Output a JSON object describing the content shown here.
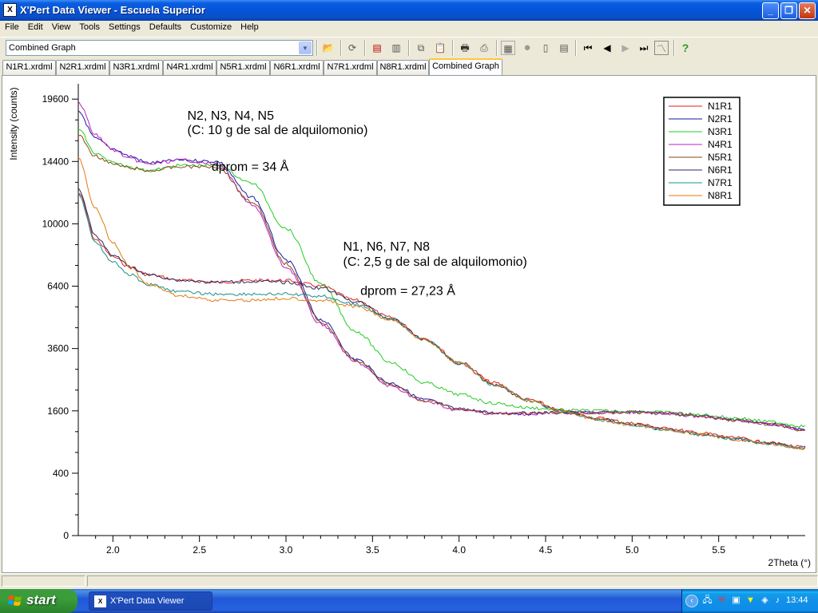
{
  "window": {
    "title": "X'Pert Data Viewer - Escuela Superior",
    "icon": "xpert-app-icon"
  },
  "menu": [
    "File",
    "Edit",
    "View",
    "Tools",
    "Settings",
    "Defaults",
    "Customize",
    "Help"
  ],
  "toolbar": {
    "graph_select_value": "Combined Graph",
    "icons": [
      "open-folder-icon",
      "refresh-icon",
      "export-icon",
      "copy-icon",
      "paste-icon",
      "print-icon",
      "print-preview-icon",
      "graph-icon",
      "stop-icon",
      "document-icon",
      "first-icon",
      "prev-icon",
      "next-icon",
      "last-icon",
      "plot-icon",
      "help-icon"
    ]
  },
  "tabs": [
    {
      "label": "N1R1.xrdml"
    },
    {
      "label": "N2R1.xrdml"
    },
    {
      "label": "N3R1.xrdml"
    },
    {
      "label": "N4R1.xrdml"
    },
    {
      "label": "N5R1.xrdml"
    },
    {
      "label": "N6R1.xrdml"
    },
    {
      "label": "N7R1.xrdml"
    },
    {
      "label": "N8R1.xrdml"
    },
    {
      "label": "Combined Graph",
      "active": true
    }
  ],
  "chart_data": {
    "type": "line",
    "xlabel": "2Theta (°)",
    "ylabel": "Intensity (counts)",
    "xlim": [
      1.8,
      6.0
    ],
    "y_ticks": [
      0,
      400,
      1600,
      3600,
      6400,
      10000,
      14400,
      19600
    ],
    "x_ticks": [
      "2.0",
      "2.5",
      "3.0",
      "3.5",
      "4.0",
      "4.5",
      "5.0",
      "5.5"
    ],
    "y_scale": "sqrt",
    "legend_position": "top-right",
    "series": [
      {
        "name": "N1R1",
        "color": "#e02020",
        "group": "low",
        "x": [
          1.8,
          1.9,
          2.0,
          2.1,
          2.2,
          2.4,
          2.6,
          2.8,
          3.0,
          3.2,
          3.4,
          3.6,
          3.8,
          4.0,
          4.2,
          4.4,
          4.6,
          4.8,
          5.0,
          5.2,
          5.4,
          5.6,
          5.8,
          6.0
        ],
        "y": [
          12100,
          9000,
          8000,
          7400,
          7000,
          6700,
          6600,
          6700,
          6700,
          6400,
          5700,
          4900,
          4000,
          3100,
          2400,
          1900,
          1600,
          1420,
          1300,
          1180,
          1080,
          980,
          880,
          800
        ]
      },
      {
        "name": "N2R1",
        "color": "#1a1aa0",
        "group": "high",
        "x": [
          1.8,
          1.9,
          2.0,
          2.1,
          2.2,
          2.4,
          2.6,
          2.8,
          3.0,
          3.2,
          3.4,
          3.6,
          3.8,
          4.0,
          4.2,
          4.4,
          4.6,
          4.8,
          5.0,
          5.2,
          5.4,
          5.6,
          5.8,
          6.0
        ],
        "y": [
          18500,
          16200,
          15400,
          14800,
          14300,
          14500,
          14400,
          11800,
          7800,
          4800,
          3200,
          2400,
          1900,
          1650,
          1550,
          1540,
          1560,
          1560,
          1570,
          1540,
          1470,
          1380,
          1280,
          1150
        ]
      },
      {
        "name": "N3R1",
        "color": "#22cc22",
        "group": "high",
        "x": [
          1.8,
          1.9,
          2.0,
          2.1,
          2.2,
          2.4,
          2.6,
          2.8,
          3.0,
          3.2,
          3.4,
          3.6,
          3.8,
          4.0,
          4.2,
          4.4,
          4.6,
          4.8,
          5.0,
          5.2,
          5.4,
          5.6,
          5.8,
          6.0
        ],
        "y": [
          17000,
          15000,
          14300,
          14000,
          13700,
          14100,
          14100,
          12800,
          9700,
          6500,
          4300,
          3100,
          2400,
          2050,
          1800,
          1680,
          1620,
          1600,
          1590,
          1560,
          1500,
          1420,
          1330,
          1230
        ]
      },
      {
        "name": "N4R1",
        "color": "#c020c0",
        "group": "high",
        "x": [
          1.8,
          1.9,
          2.0,
          2.1,
          2.2,
          2.4,
          2.6,
          2.8,
          3.0,
          3.2,
          3.4,
          3.6,
          3.8,
          4.0,
          4.2,
          4.4,
          4.6,
          4.8,
          5.0,
          5.2,
          5.4,
          5.6,
          5.8,
          6.0
        ],
        "y": [
          19300,
          16500,
          15300,
          14600,
          14200,
          14500,
          14200,
          11300,
          7400,
          4600,
          3100,
          2300,
          1850,
          1620,
          1530,
          1520,
          1550,
          1550,
          1560,
          1530,
          1460,
          1370,
          1270,
          1140
        ]
      },
      {
        "name": "N5R1",
        "color": "#8b4a1a",
        "group": "high",
        "x": [
          1.8,
          1.9,
          2.0,
          2.1,
          2.2,
          2.4,
          2.6,
          2.8,
          3.0,
          3.2,
          3.4,
          3.6,
          3.8,
          4.0,
          4.2,
          4.4,
          4.6,
          4.8,
          5.0,
          5.2,
          5.4,
          5.6,
          5.8,
          6.0
        ],
        "y": [
          16500,
          14800,
          14200,
          13900,
          13700,
          14000,
          14000,
          11500,
          7600,
          4700,
          3150,
          2350,
          1880,
          1640,
          1540,
          1530,
          1550,
          1550,
          1560,
          1530,
          1460,
          1370,
          1270,
          1140
        ]
      },
      {
        "name": "N6R1",
        "color": "#2a2a60",
        "group": "low",
        "x": [
          1.8,
          1.9,
          2.0,
          2.1,
          2.2,
          2.4,
          2.6,
          2.8,
          3.0,
          3.2,
          3.4,
          3.6,
          3.8,
          4.0,
          4.2,
          4.4,
          4.6,
          4.8,
          5.0,
          5.2,
          5.4,
          5.6,
          5.8,
          6.0
        ],
        "y": [
          12400,
          9200,
          8100,
          7450,
          7000,
          6700,
          6600,
          6650,
          6600,
          6300,
          5650,
          4850,
          3950,
          3050,
          2350,
          1880,
          1580,
          1400,
          1280,
          1160,
          1060,
          960,
          870,
          790
        ]
      },
      {
        "name": "N7R1",
        "color": "#1a8f8f",
        "group": "low",
        "x": [
          1.8,
          1.9,
          2.0,
          2.1,
          2.2,
          2.4,
          2.6,
          2.8,
          3.0,
          3.2,
          3.4,
          3.6,
          3.8,
          4.0,
          4.2,
          4.4,
          4.6,
          4.8,
          5.0,
          5.2,
          5.4,
          5.6,
          5.8,
          6.0
        ],
        "y": [
          12000,
          8800,
          7700,
          7000,
          6500,
          6100,
          6000,
          6000,
          6000,
          5900,
          5500,
          4850,
          3950,
          3050,
          2350,
          1880,
          1570,
          1380,
          1260,
          1150,
          1050,
          950,
          860,
          780
        ]
      },
      {
        "name": "N8R1",
        "color": "#e07a10",
        "group": "low",
        "x": [
          1.8,
          1.9,
          2.0,
          2.1,
          2.2,
          2.4,
          2.6,
          2.8,
          3.0,
          3.2,
          3.4,
          3.6,
          3.8,
          4.0,
          4.2,
          4.4,
          4.6,
          4.8,
          5.0,
          5.2,
          5.4,
          5.6,
          5.8,
          6.0
        ],
        "y": [
          14600,
          11000,
          8800,
          7400,
          6500,
          5900,
          5700,
          5700,
          5800,
          5700,
          5400,
          4800,
          3950,
          3050,
          2350,
          1880,
          1570,
          1380,
          1260,
          1150,
          1050,
          950,
          860,
          780
        ]
      }
    ],
    "annotations": [
      {
        "text": "N2, N3, N4, N5",
        "anchor_x": 2.43,
        "anchor_y": 17800
      },
      {
        "text": "(C: 10 g de sal de alquilomonio)",
        "anchor_x": 2.43,
        "anchor_y": 16600
      },
      {
        "text": "dprom = 34 Å",
        "anchor_x": 2.57,
        "anchor_y": 13700
      },
      {
        "text": "N1, N6, N7, N8",
        "anchor_x": 3.33,
        "anchor_y": 8350
      },
      {
        "text": "(C: 2,5 g de sal de alquilomonio)",
        "anchor_x": 3.33,
        "anchor_y": 7500
      },
      {
        "text": "dprom = 27,23 Å",
        "anchor_x": 3.43,
        "anchor_y": 5950
      }
    ]
  },
  "taskbar": {
    "start_label": "start",
    "task_label": "X'Pert Data Viewer",
    "clock": "13:44"
  }
}
